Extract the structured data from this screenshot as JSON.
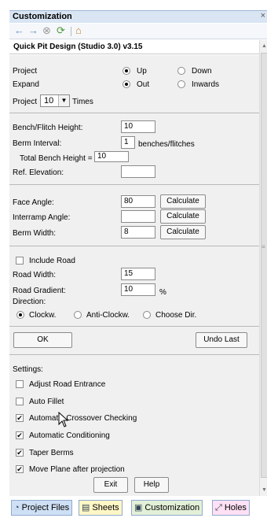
{
  "window": {
    "title": "Customization",
    "close_symbol": "×"
  },
  "nav": {
    "back_icon": "←",
    "forward_icon": "→",
    "stop_icon": "⊗",
    "refresh_icon": "⟳",
    "home_icon": "⌂"
  },
  "header": {
    "title": "Quick Pit Design (Studio 3.0) v3.15"
  },
  "project": {
    "label": "Project",
    "opt_up": "Up",
    "opt_down": "Down",
    "expand_label": "Expand",
    "opt_out": "Out",
    "opt_inwards": "Inwards",
    "count_prefix": "Project",
    "count_value": "10",
    "count_suffix": "Times"
  },
  "bench": {
    "height_label": "Bench/Flitch Height:",
    "height_value": "10",
    "interval_label": "Berm Interval:",
    "interval_value": "1",
    "interval_suffix": "benches/flitches",
    "total_label": "Total Bench Height =",
    "total_value": "10",
    "ref_label": "Ref. Elevation:",
    "ref_value": ""
  },
  "angles": {
    "face_label": "Face Angle:",
    "face_value": "80",
    "interramp_label": "Interramp Angle:",
    "interramp_value": "",
    "berm_label": "Berm Width:",
    "berm_value": "8",
    "calculate": "Calculate"
  },
  "road": {
    "include_label": "Include Road",
    "width_label": "Road Width:",
    "width_value": "15",
    "gradient_label": "Road Gradient:",
    "gradient_value": "10",
    "gradient_unit": "%",
    "direction_label": "Direction:",
    "dir_clockw": "Clockw.",
    "dir_anti": "Anti-Clockw.",
    "dir_choose": "Choose Dir."
  },
  "actions": {
    "ok": "OK",
    "undo": "Undo Last"
  },
  "settings": {
    "label": "Settings:",
    "adjust_road": "Adjust Road Entrance",
    "auto_fillet": "Auto Fillet",
    "crossover": "Automatic Crossover Checking",
    "conditioning": "Automatic Conditioning",
    "taper": "Taper Berms",
    "move_plane": "Move Plane after projection",
    "check_mark": "✔"
  },
  "footer": {
    "exit": "Exit",
    "help": "Help"
  },
  "tabs": {
    "project_files": "Project Files",
    "sheets": "Sheets",
    "customization": "Customization",
    "holes": "Holes",
    "pf_icon": "◔",
    "sheets_icon": "▤",
    "cust_icon": "▣",
    "holes_icon": "⤢"
  }
}
